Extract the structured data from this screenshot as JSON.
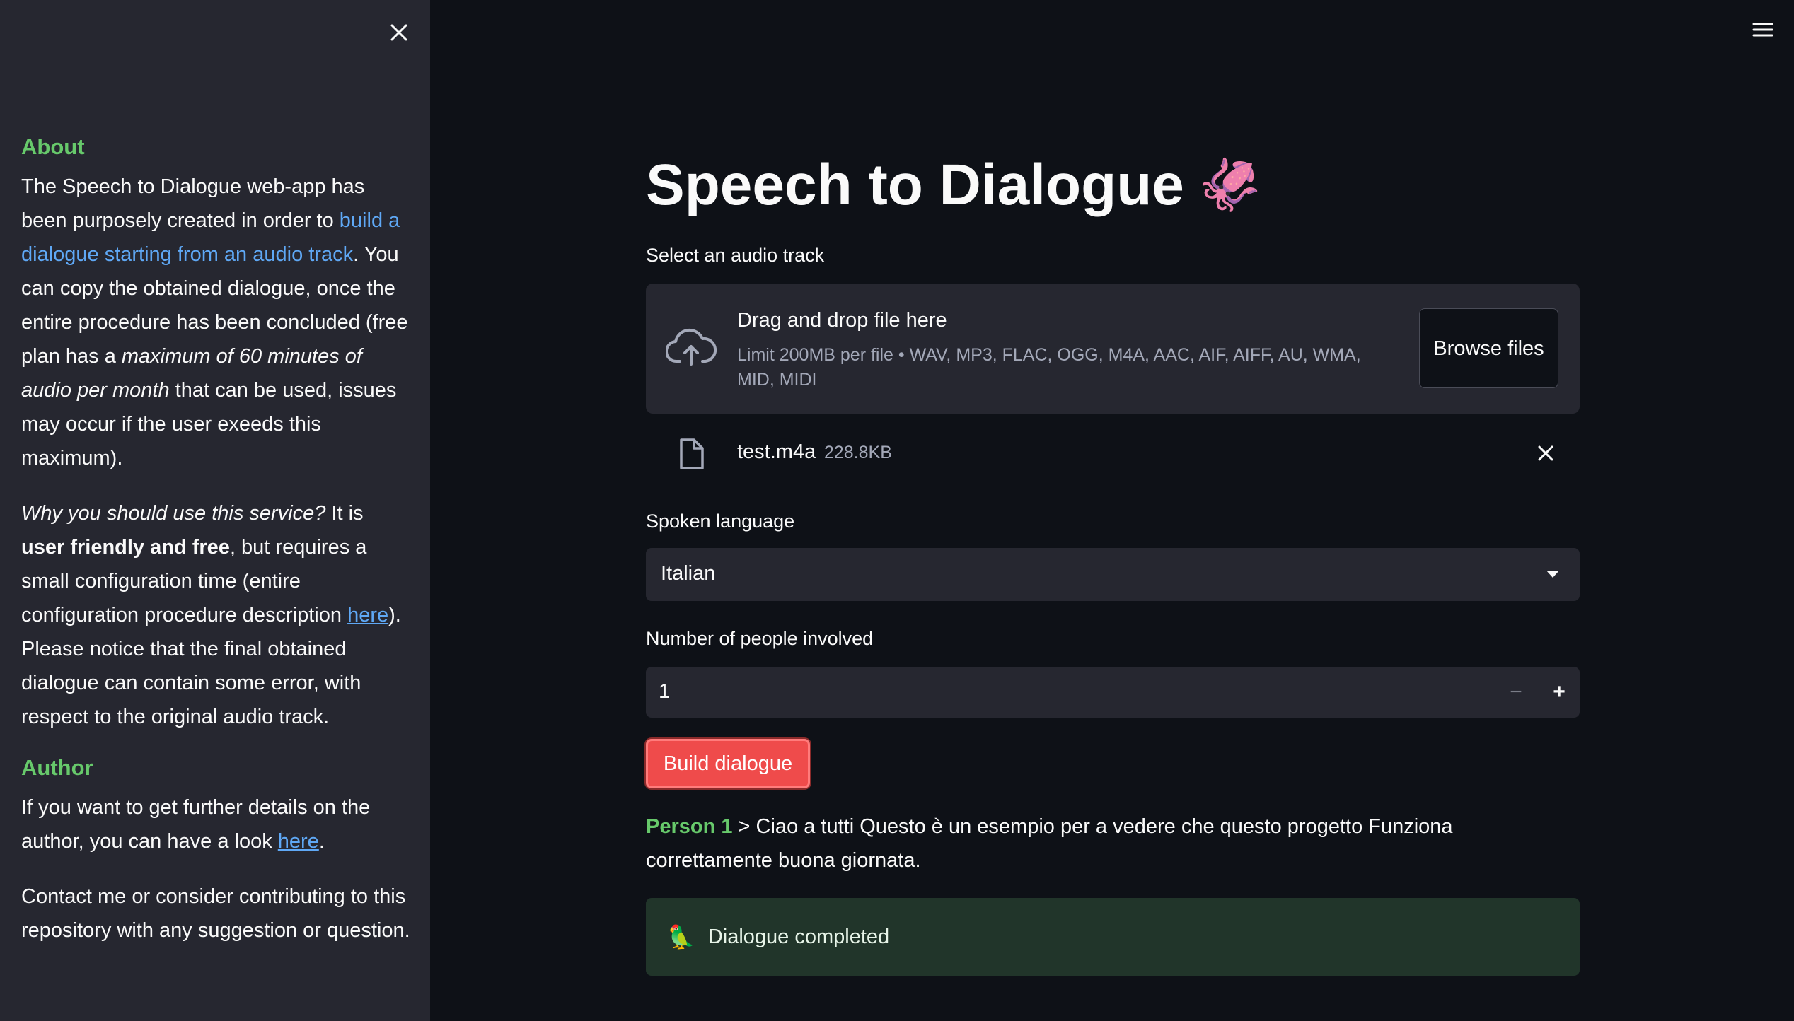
{
  "sidebar": {
    "about_heading": "About",
    "about_p1": {
      "t1": "The Speech to Dialogue web-app has been purposely created in order to ",
      "link": "build a dialogue starting from an audio track",
      "t2": ". You can copy the obtained dialogue, once the entire procedure has been concluded (free plan has a ",
      "em": "maximum of 60 minutes of audio per month",
      "t3": " that can be used, issues may occur if the user exeeds this maximum)."
    },
    "about_p2": {
      "em": "Why you should use this service?",
      "t1": " It is ",
      "strong": "user friendly and free",
      "t2": ", but requires a small configuration time (entire configuration procedure description ",
      "link": "here",
      "t3": "). Please notice that the final obtained dialogue can contain some error, with respect to the original audio track."
    },
    "author_heading": "Author",
    "author_p": {
      "t1": "If you want to get further details on the author, you can have a look ",
      "link": "here",
      "t2": "."
    },
    "contact": "Contact me or consider contributing to this repository with any suggestion or question."
  },
  "main": {
    "title": "Speech to Dialogue",
    "title_emoji": "🦑",
    "uploader": {
      "label": "Select an audio track",
      "main": "Drag and drop file here",
      "limit": "Limit 200MB per file • WAV, MP3, FLAC, OGG, M4A, AAC, AIF, AIFF, AU, WMA, MID, MIDI",
      "browse": "Browse files"
    },
    "file": {
      "name": "test.m4a",
      "size": "228.8KB"
    },
    "language": {
      "label": "Spoken language",
      "value": "Italian"
    },
    "people": {
      "label": "Number of people involved",
      "value": "1",
      "minus": "−",
      "plus": "+"
    },
    "build_button": "Build dialogue",
    "dialogue": {
      "speaker": "Person 1",
      "text": " > Ciao a tutti Questo è un esempio per a vedere che questo progetto Funziona correttamente buona giornata."
    },
    "success": {
      "emoji": "🦜",
      "text": "Dialogue completed"
    }
  },
  "colors": {
    "background": "#0e1117",
    "sidebar": "#262730",
    "accent_green": "#67c96b",
    "link": "#5fa8f5",
    "primary_button": "#ef4b4b",
    "success_bg": "#21352a"
  },
  "icons": {
    "sidebar_close": "close-icon",
    "menu": "hamburger-menu-icon",
    "upload": "cloud-upload-icon",
    "file": "file-icon",
    "remove_file": "close-icon",
    "select_arrow": "caret-down-icon"
  }
}
